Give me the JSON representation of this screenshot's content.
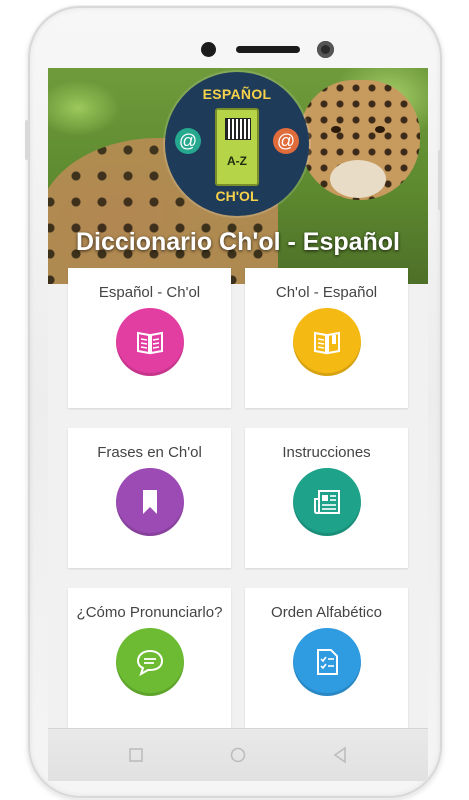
{
  "app": {
    "title": "Diccionario Ch'ol - Español",
    "logo_top": "ESPAÑOL",
    "logo_bottom": "CH'OL",
    "logo_book_text": "A-Z"
  },
  "menu": [
    {
      "label": "Español - Ch'ol",
      "icon": "open-book-icon",
      "color": "#e23da0"
    },
    {
      "label": "Ch'ol - Español",
      "icon": "open-book-icon",
      "color": "#f5b914"
    },
    {
      "label": "Frases en Ch'ol",
      "icon": "bookmark-icon",
      "color": "#9b4bb3"
    },
    {
      "label": "Instrucciones",
      "icon": "newspaper-icon",
      "color": "#1ea28a"
    },
    {
      "label": "¿Cómo Pronunciarlo?",
      "icon": "chat-bubble-icon",
      "color": "#6cbb32"
    },
    {
      "label": "Orden Alfabético",
      "icon": "checklist-icon",
      "color": "#2f9be0"
    }
  ],
  "navbar": {
    "buttons": [
      "recents-square-icon",
      "home-circle-icon",
      "back-triangle-icon"
    ]
  }
}
